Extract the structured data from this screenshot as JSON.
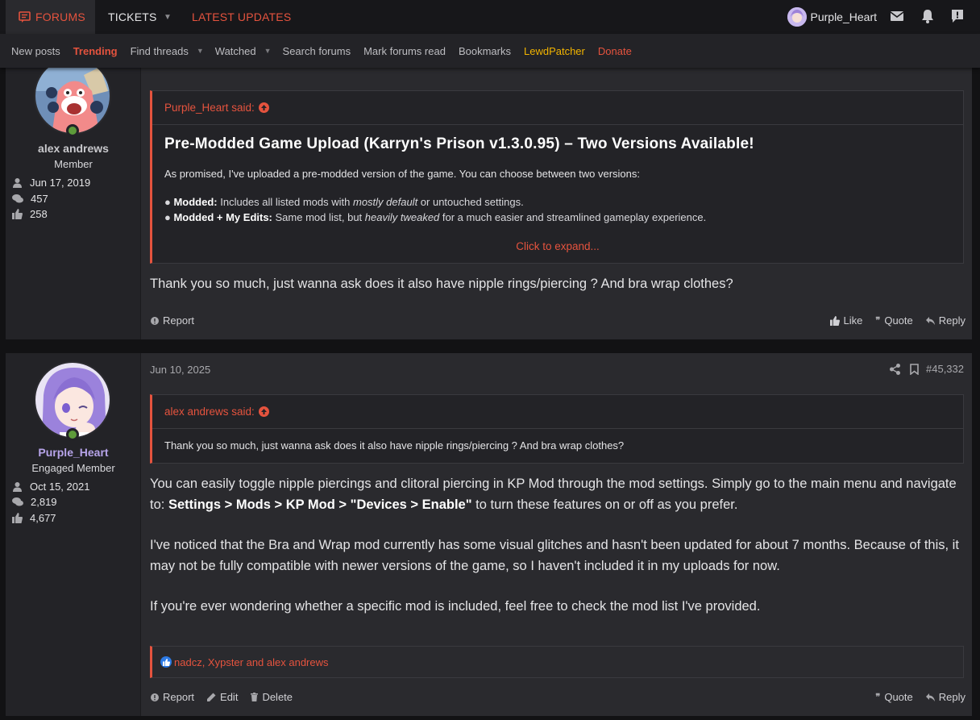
{
  "topnav": {
    "forums": "FORUMS",
    "tickets": "TICKETS",
    "latest_updates": "LATEST UPDATES",
    "username": "Purple_Heart"
  },
  "subnav": {
    "new_posts": "New posts",
    "trending": "Trending",
    "find_threads": "Find threads",
    "watched": "Watched",
    "search_forums": "Search forums",
    "mark_read": "Mark forums read",
    "bookmarks": "Bookmarks",
    "lewdpatcher": "LewdPatcher",
    "donate": "Donate"
  },
  "post1": {
    "author": "alex andrews",
    "user_title": "Member",
    "joined": "Jun 17, 2019",
    "messages": "457",
    "reactions": "258",
    "quote_author": "Purple_Heart said:",
    "quote_title": "Pre-Modded Game Upload (Karryn's Prison v1.3.0.95) – Two Versions Available!",
    "quote_line1": "As promised, I've uploaded a pre-modded version of the game. You can choose between two versions:",
    "bullet1_bold": "Modded:",
    "bullet1_a": " Includes all listed mods with ",
    "bullet1_em": "mostly default",
    "bullet1_b": " or untouched settings.",
    "bullet2_bold": "Modded + My Edits:",
    "bullet2_a": " Same mod list, but ",
    "bullet2_em": "heavily tweaked",
    "bullet2_b": " for a much easier and streamlined gameplay experience.",
    "click_expand": "Click to expand...",
    "message": "Thank you so much, just wanna ask does it also have nipple rings/piercing ? And bra wrap clothes?",
    "report": "Report",
    "like": "Like",
    "quote": "Quote",
    "reply": "Reply"
  },
  "post2": {
    "date": "Jun 10, 2025",
    "post_number": "#45,332",
    "author": "Purple_Heart",
    "user_title": "Engaged Member",
    "joined": "Oct 15, 2021",
    "messages": "2,819",
    "reactions": "4,677",
    "quote_author": "alex andrews said:",
    "quote_text": "Thank you so much, just wanna ask does it also have nipple rings/piercing ? And bra wrap clothes?",
    "p1_a": "You can easily toggle nipple piercings and clitoral piercing in KP Mod through the mod settings. Simply go to the main menu and navigate to: ",
    "p1_bold": "Settings > Mods > KP Mod > \"Devices > Enable\"",
    "p1_b": " to turn these features on or off as you prefer.",
    "p2": "I've noticed that the Bra and Wrap mod currently has some visual glitches and hasn't been updated for about 7 months. Because of this, it may not be fully compatible with newer versions of the game, so I haven't included it in my uploads for now.",
    "p3": "If you're ever wondering whether a specific mod is included, feel free to check the mod list I've provided.",
    "reacted_by": "nadcz, Xypster and alex andrews",
    "report": "Report",
    "edit": "Edit",
    "delete": "Delete",
    "quote": "Quote",
    "reply": "Reply"
  },
  "colors": {
    "accent": "#e5533e",
    "gold": "#f2b400",
    "online": "#5e9b3a",
    "like_blue": "#2d7ae5"
  },
  "icons": [
    "forums-icon",
    "mail-icon",
    "bell-icon",
    "alert-icon",
    "user-icon",
    "messages-icon",
    "thumbs-up-icon",
    "share-icon",
    "bookmark-icon",
    "report-icon",
    "quote-icon",
    "reply-icon",
    "edit-icon",
    "delete-icon"
  ]
}
